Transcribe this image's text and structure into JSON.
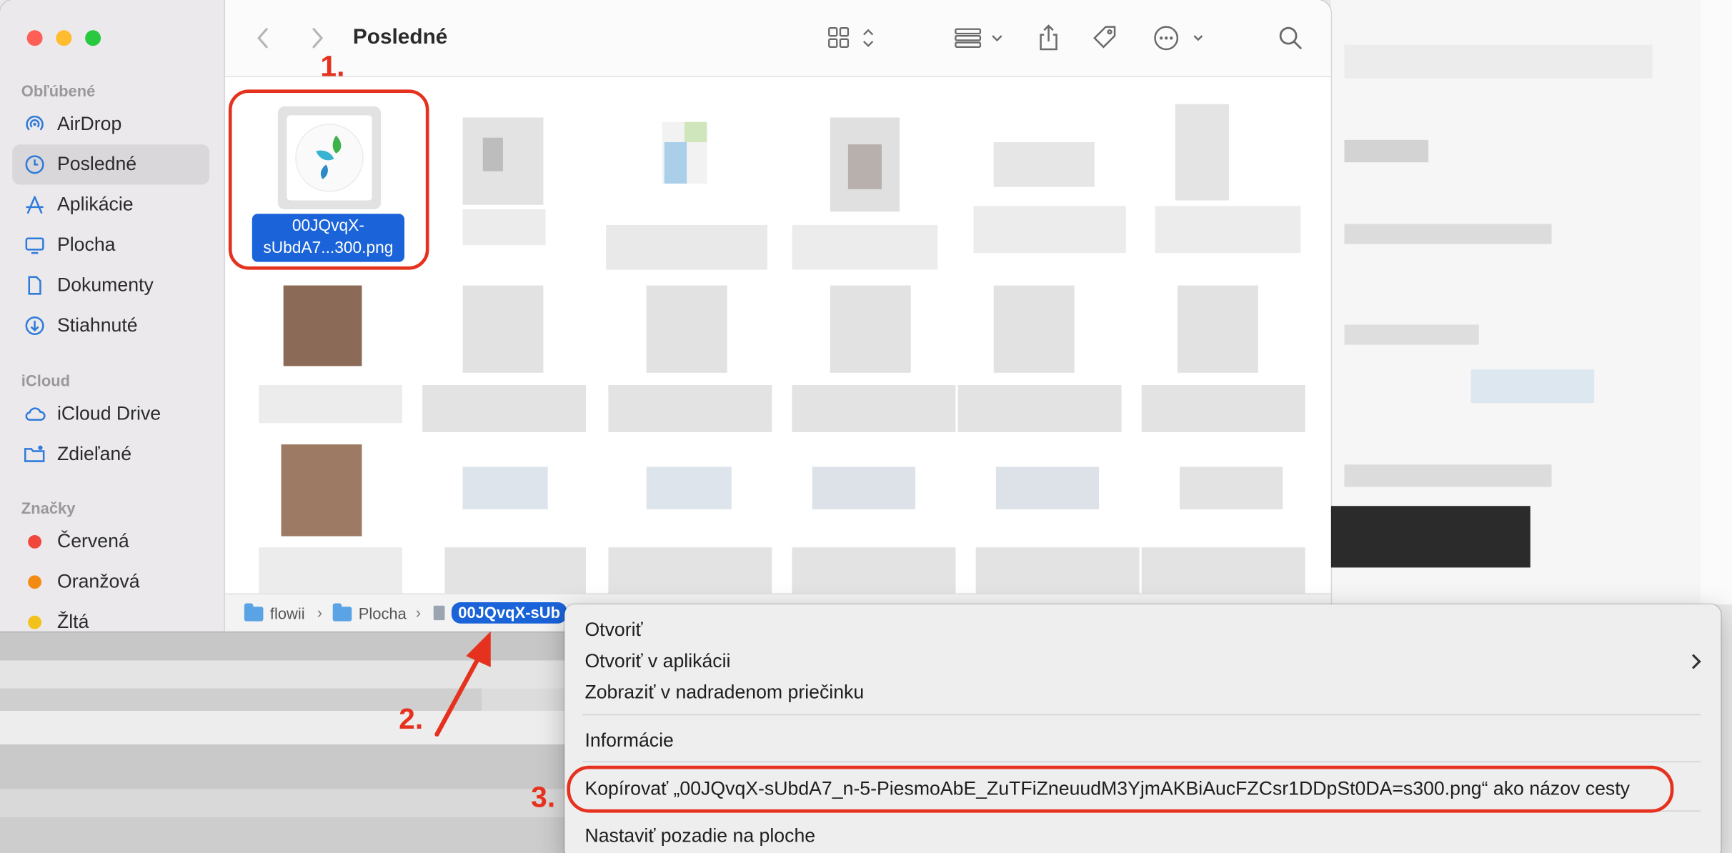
{
  "sidebar": {
    "sections": {
      "favorites": "Obľúbené",
      "icloud": "iCloud",
      "tags": "Značky"
    },
    "favorites": [
      {
        "label": "AirDrop",
        "icon": "airdrop-icon"
      },
      {
        "label": "Posledné",
        "icon": "clock-icon",
        "selected": true
      },
      {
        "label": "Aplikácie",
        "icon": "applications-icon"
      },
      {
        "label": "Plocha",
        "icon": "desktop-icon"
      },
      {
        "label": "Dokumenty",
        "icon": "document-icon"
      },
      {
        "label": "Stiahnuté",
        "icon": "download-icon"
      }
    ],
    "icloud": [
      {
        "label": "iCloud Drive",
        "icon": "cloud-icon"
      },
      {
        "label": "Zdieľané",
        "icon": "shared-folder-icon"
      }
    ],
    "tags": [
      {
        "label": "Červená",
        "color": "#f0463c"
      },
      {
        "label": "Oranžová",
        "color": "#f38b12"
      },
      {
        "label": "Žltá",
        "color": "#f2c21b"
      }
    ]
  },
  "toolbar": {
    "title": "Posledné",
    "icons": [
      "back-icon",
      "forward-icon",
      "grid-view-icon",
      "group-icon",
      "share-icon",
      "tag-icon",
      "more-icon",
      "search-icon"
    ]
  },
  "file": {
    "name_line1": "00JQvqX-",
    "name_line2": "sUbdA7...300.png"
  },
  "pathbar": {
    "crumbs": [
      "flowii",
      "Plocha",
      "00JQvqX-sUb"
    ]
  },
  "context_menu": {
    "items": {
      "open": "Otvoriť",
      "open_with": "Otvoriť v aplikácii",
      "show_in_folder": "Zobraziť v nadradenom priečinku",
      "info": "Informácie",
      "copy_path": "Kopírovať „00JQvqX-sUbdA7_n-5-PiesmoAbE_ZuTFiZneuudM3YjmAKBiAucFZCsr1DDpSt0DA=s300.png“ ako názov cesty",
      "set_wallpaper": "Nastaviť pozadie na ploche"
    }
  },
  "annotations": [
    "1.",
    "2.",
    "3."
  ],
  "colors": {
    "accent": "#1a63d8",
    "annotation": "#e5321f",
    "close": "#ff5f57",
    "minimize": "#febc2e",
    "zoom": "#28c840"
  }
}
